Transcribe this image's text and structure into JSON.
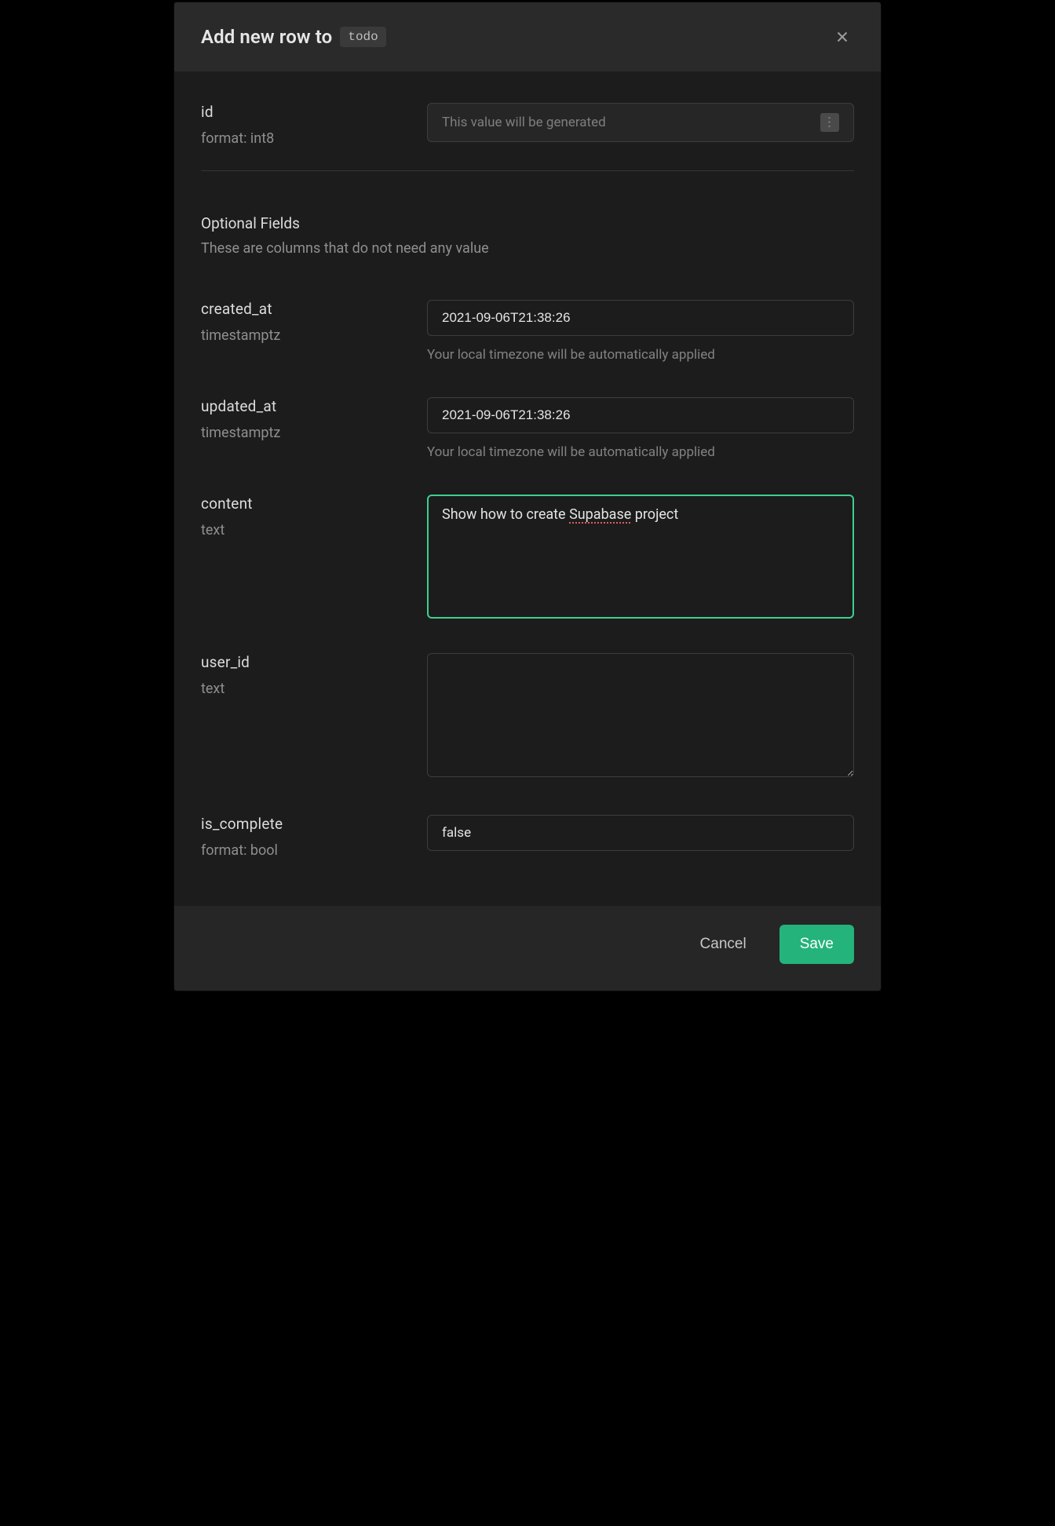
{
  "header": {
    "title_prefix": "Add new row to",
    "table_name": "todo"
  },
  "fields": {
    "id": {
      "name": "id",
      "format_label": "format: int8",
      "placeholder": "This value will be generated"
    }
  },
  "optional_section": {
    "title": "Optional Fields",
    "subtitle": "These are columns that do not need any value"
  },
  "optional_fields": {
    "created_at": {
      "name": "created_at",
      "type_label": "timestamptz",
      "value": "2021-09-06T21:38:26",
      "helper": "Your local timezone will be automatically applied"
    },
    "updated_at": {
      "name": "updated_at",
      "type_label": "timestamptz",
      "value": "2021-09-06T21:38:26",
      "helper": "Your local timezone will be automatically applied"
    },
    "content": {
      "name": "content",
      "type_label": "text",
      "value_pre": "Show how to create ",
      "value_mark": "Supabase",
      "value_post": " project"
    },
    "user_id": {
      "name": "user_id",
      "type_label": "text",
      "value": ""
    },
    "is_complete": {
      "name": "is_complete",
      "format_label": "format: bool",
      "value": "false"
    }
  },
  "footer": {
    "cancel_label": "Cancel",
    "save_label": "Save"
  }
}
